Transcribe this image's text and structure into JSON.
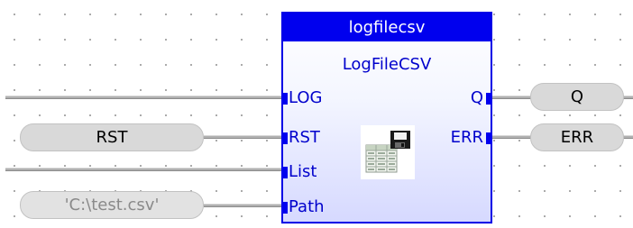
{
  "block": {
    "instance_name": "logfilecsv",
    "type_name": "LogFileCSV",
    "inputs": [
      "LOG",
      "RST",
      "List",
      "Path"
    ],
    "outputs": [
      "Q",
      "ERR"
    ],
    "icon": "floppy-disk-table-icon"
  },
  "variables": {
    "rst_input": "RST",
    "path_input": "'C:\\test.csv'",
    "q_output": "Q",
    "err_output": "ERR"
  }
}
